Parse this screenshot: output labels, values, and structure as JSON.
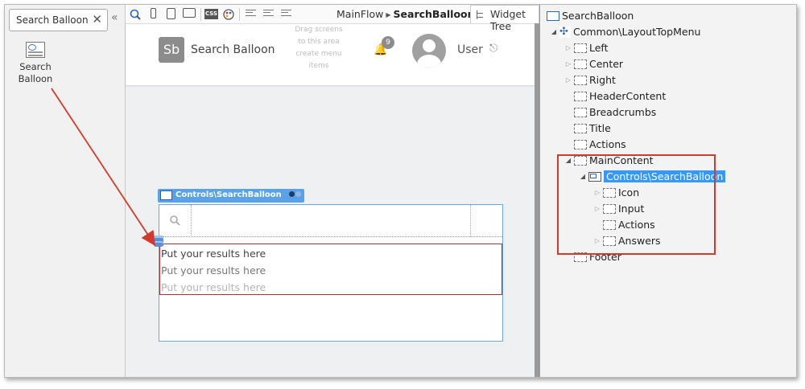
{
  "toolbox": {
    "search_value": "Search Balloon",
    "clear_glyph": "✕",
    "collapse_glyph": "«",
    "widget_label": "Search Balloon"
  },
  "toolbar": {
    "css_label": "CSS",
    "breadcrumb": {
      "flow": "MainFlow",
      "screen": "SearchBalloon"
    }
  },
  "screen": {
    "logo_text": "Sb",
    "app_name": "Search Balloon",
    "drag_hint": "Drag screens to this area create menu items",
    "notification_count": "9",
    "user_name": "User"
  },
  "search_balloon": {
    "label": "Controls\\SearchBalloon",
    "results": [
      "Put your results here",
      "Put your results here",
      "Put your results here"
    ]
  },
  "widget_tree": {
    "tab_label": "Widget Tree",
    "nodes": [
      {
        "label": "SearchBalloon"
      },
      {
        "label": "Common\\LayoutTopMenu"
      },
      {
        "label": "Left"
      },
      {
        "label": "Center"
      },
      {
        "label": "Right"
      },
      {
        "label": "HeaderContent"
      },
      {
        "label": "Breadcrumbs"
      },
      {
        "label": "Title"
      },
      {
        "label": "Actions"
      },
      {
        "label": "MainContent"
      },
      {
        "label": "Controls\\SearchBalloon"
      },
      {
        "label": "Icon"
      },
      {
        "label": "Input"
      },
      {
        "label": "Actions"
      },
      {
        "label": "Answers"
      },
      {
        "label": "Footer"
      }
    ]
  },
  "colors": {
    "annotation": "#d33a2c",
    "selection": "#3399ff",
    "balloon_label": "#5aa2e8"
  }
}
